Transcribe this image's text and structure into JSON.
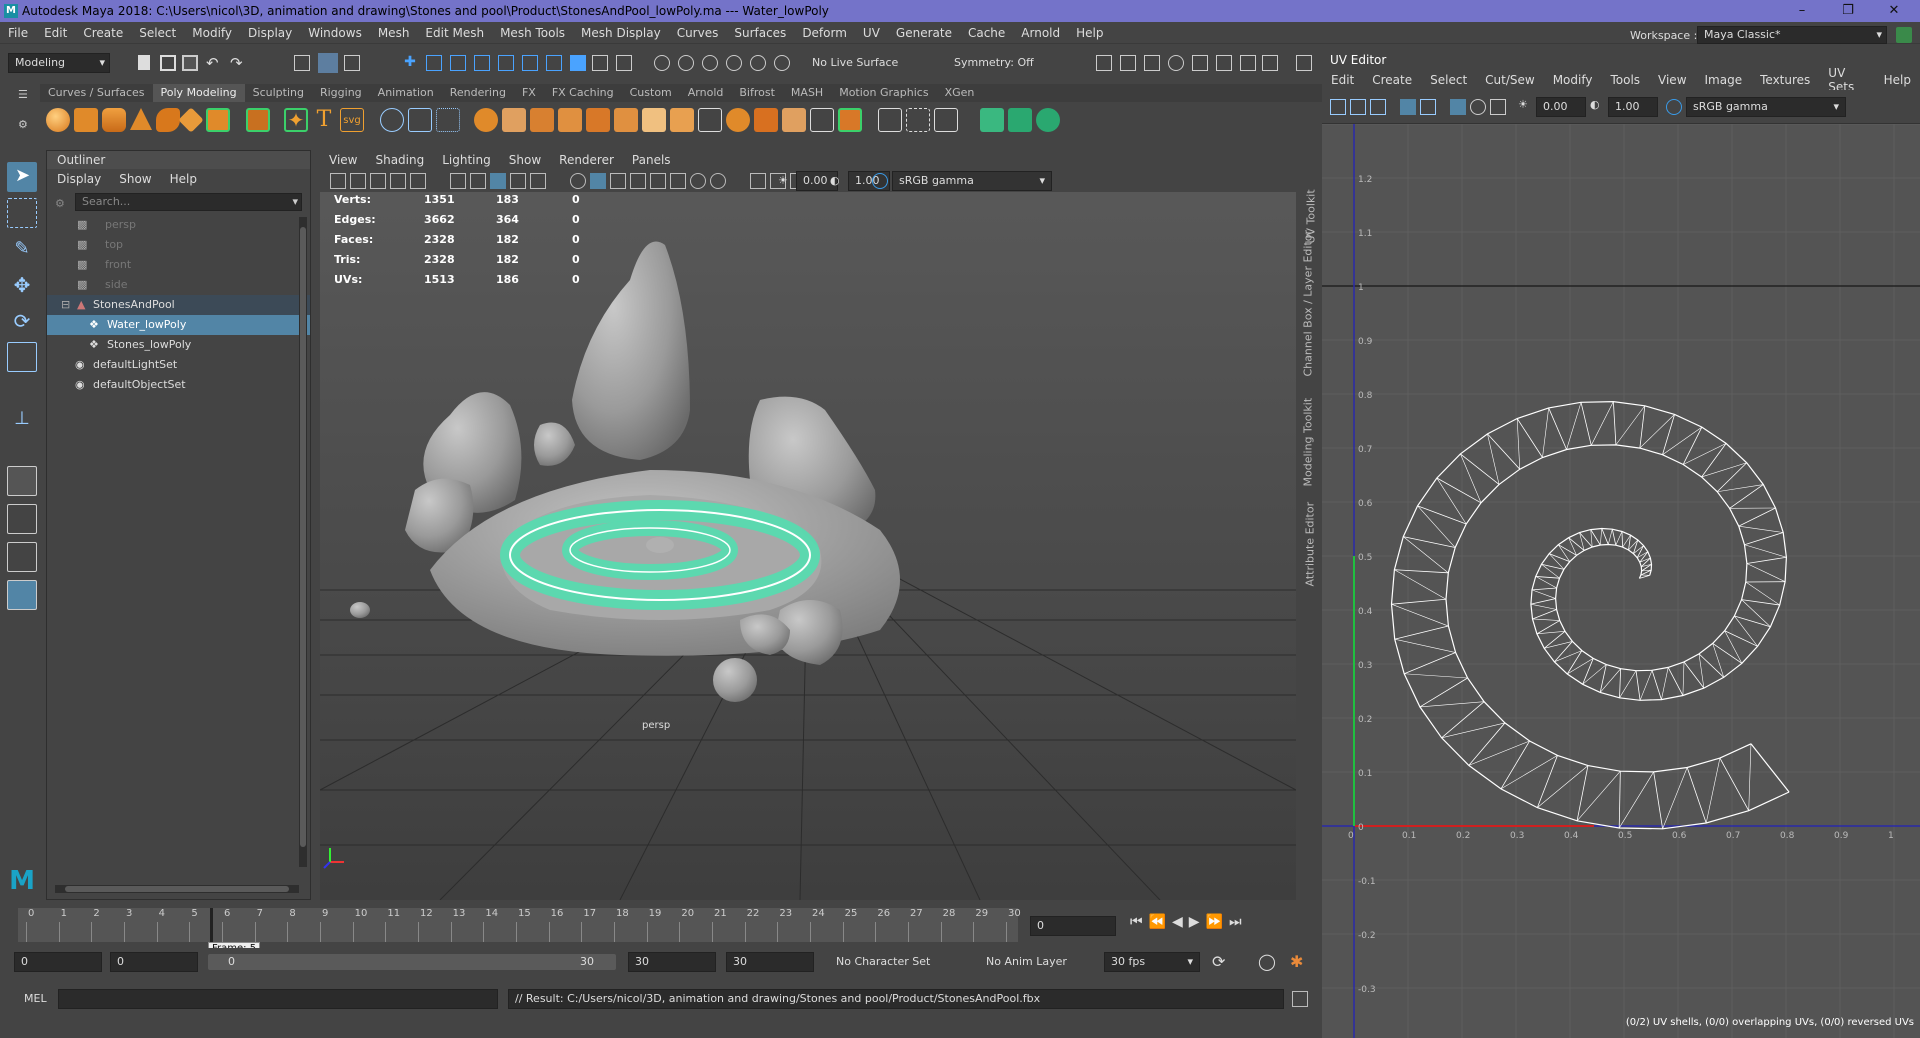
{
  "window": {
    "title": "Autodesk Maya 2018: C:\\Users\\nicol\\3D, animation and drawing\\Stones and pool\\Product\\StonesAndPool_lowPoly.ma  ---  Water_lowPoly",
    "logo_letter": "M"
  },
  "menu": [
    "File",
    "Edit",
    "Create",
    "Select",
    "Modify",
    "Display",
    "Windows",
    "Mesh",
    "Edit Mesh",
    "Mesh Tools",
    "Mesh Display",
    "Curves",
    "Surfaces",
    "Deform",
    "UV",
    "Generate",
    "Cache",
    "Arnold",
    "Help"
  ],
  "toolbar": {
    "mode": "Modeling",
    "live_surface": "No Live Surface",
    "symmetry": "Symmetry: Off",
    "workspace_label": "Workspace :",
    "workspace_value": "Maya Classic*"
  },
  "shelf_tabs": [
    "Curves / Surfaces",
    "Poly Modeling",
    "Sculpting",
    "Rigging",
    "Animation",
    "Rendering",
    "FX",
    "FX Caching",
    "Custom",
    "Arnold",
    "Bifrost",
    "MASH",
    "Motion Graphics",
    "XGen"
  ],
  "shelf_active": "Poly Modeling",
  "outliner": {
    "title": "Outliner",
    "menu": [
      "Display",
      "Show",
      "Help"
    ],
    "search_placeholder": "Search...",
    "items": [
      {
        "label": "persp",
        "icon": "camera-icon",
        "state": "dim"
      },
      {
        "label": "top",
        "icon": "camera-icon",
        "state": "dim"
      },
      {
        "label": "front",
        "icon": "camera-icon",
        "state": "dim"
      },
      {
        "label": "side",
        "icon": "camera-icon",
        "state": "dim"
      },
      {
        "label": "StonesAndPool",
        "icon": "group-icon",
        "state": "group"
      },
      {
        "label": "Water_lowPoly",
        "icon": "mesh-icon",
        "state": "selected"
      },
      {
        "label": "Stones_lowPoly",
        "icon": "mesh-icon",
        "state": "normal"
      },
      {
        "label": "defaultLightSet",
        "icon": "set-icon",
        "state": "normal"
      },
      {
        "label": "defaultObjectSet",
        "icon": "set-icon",
        "state": "normal"
      }
    ]
  },
  "viewport": {
    "menu": [
      "View",
      "Shading",
      "Lighting",
      "Show",
      "Renderer",
      "Panels"
    ],
    "exposure": "0.00",
    "gamma": "1.00",
    "color_space": "sRGB gamma",
    "camera_label": "persp",
    "stats": [
      {
        "label": "Verts:",
        "a": "1351",
        "b": "183",
        "c": "0"
      },
      {
        "label": "Edges:",
        "a": "3662",
        "b": "364",
        "c": "0"
      },
      {
        "label": "Faces:",
        "a": "2328",
        "b": "182",
        "c": "0"
      },
      {
        "label": "Tris:",
        "a": "2328",
        "b": "182",
        "c": "0"
      },
      {
        "label": "UVs:",
        "a": "1513",
        "b": "186",
        "c": "0"
      }
    ]
  },
  "side_tabs": [
    "UV Toolkit",
    "Channel Box / Layer Editor",
    "Modeling Toolkit",
    "Attribute Editor"
  ],
  "timeline": {
    "ticks": [
      "0",
      "1",
      "2",
      "3",
      "4",
      "5",
      "6",
      "7",
      "8",
      "9",
      "10",
      "11",
      "12",
      "13",
      "14",
      "15",
      "16",
      "17",
      "18",
      "19",
      "20",
      "21",
      "22",
      "23",
      "24",
      "25",
      "26",
      "27",
      "28",
      "29",
      "30"
    ],
    "current_frame": "0",
    "frame_tooltip": "Frame: 5",
    "range_start": "0",
    "range_inner_start": "0",
    "slider_start": "0",
    "slider_end": "30",
    "range_inner_end": "30",
    "range_end": "30",
    "character_set": "No Character Set",
    "anim_layer": "No Anim Layer",
    "fps": "30 fps"
  },
  "mel": {
    "label": "MEL",
    "result": "// Result: C:/Users/nicol/3D, animation and drawing/Stones and pool/Product/StonesAndPool.fbx"
  },
  "uv_editor": {
    "title": "UV Editor",
    "menu": [
      "Edit",
      "Create",
      "Select",
      "Cut/Sew",
      "Modify",
      "Tools",
      "View",
      "Image",
      "Textures",
      "UV Sets",
      "Help"
    ],
    "exposure": "0.00",
    "gamma": "1.00",
    "color_space": "sRGB gamma",
    "v_labels": [
      "1.2",
      "1.1",
      "1",
      "0.9",
      "0.8",
      "0.7",
      "0.6",
      "0.5",
      "0.4",
      "0.3",
      "0.2",
      "0.1",
      "0",
      "-0.1",
      "-0.2",
      "-0.3"
    ],
    "u_labels": [
      "0",
      "0.1",
      "0.2",
      "0.3",
      "0.4",
      "0.5",
      "0.6",
      "0.7",
      "0.8",
      "0.9",
      "1"
    ],
    "status": "(0/2) UV shells, (0/0) overlapping UVs, (0/0) reversed UVs"
  },
  "colors": {
    "title_bar": "#7473c9",
    "selection": "#5285a6",
    "uv_wire": "#ffffff",
    "mesh_highlight": "#4fe0b0"
  }
}
